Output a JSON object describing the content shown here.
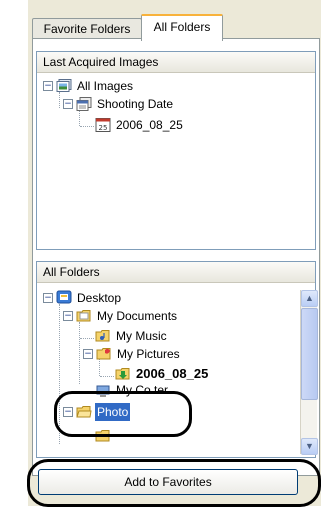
{
  "tabs": [
    {
      "label": "Favorite Folders",
      "active": false
    },
    {
      "label": "All Folders",
      "active": true
    }
  ],
  "last_acquired": {
    "header": "Last Acquired Images",
    "items": [
      {
        "label": "All Images",
        "icon": "image-stack-icon",
        "expander": "−"
      },
      {
        "label": "Shooting Date",
        "icon": "calendar-icon",
        "expander": "−"
      },
      {
        "label": "2006_08_25",
        "icon": "date-folder-icon"
      }
    ]
  },
  "all_folders": {
    "header": "All Folders",
    "items": [
      {
        "label": "Desktop",
        "icon": "desktop-icon",
        "expander": "−"
      },
      {
        "label": "My Documents",
        "icon": "folder-open-icon",
        "expander": "−"
      },
      {
        "label": "My Music",
        "icon": "music-folder-icon"
      },
      {
        "label": "My Pictures",
        "icon": "pictures-folder-icon",
        "expander": "−"
      },
      {
        "label": "2006_08_25",
        "icon": "import-folder-icon",
        "bold": true
      },
      {
        "label": "My Computer",
        "visible_text": "My Co   ter",
        "icon": "computer-icon"
      },
      {
        "label": "Photo",
        "icon": "folder-open-icon",
        "expander": "−",
        "selected": true
      }
    ]
  },
  "scrollbar": {
    "up": "▲",
    "down": "▼"
  },
  "add_button": {
    "label": "Add to Favorites"
  },
  "colors": {
    "selection": "#316ac5",
    "annotation": "#000000"
  }
}
